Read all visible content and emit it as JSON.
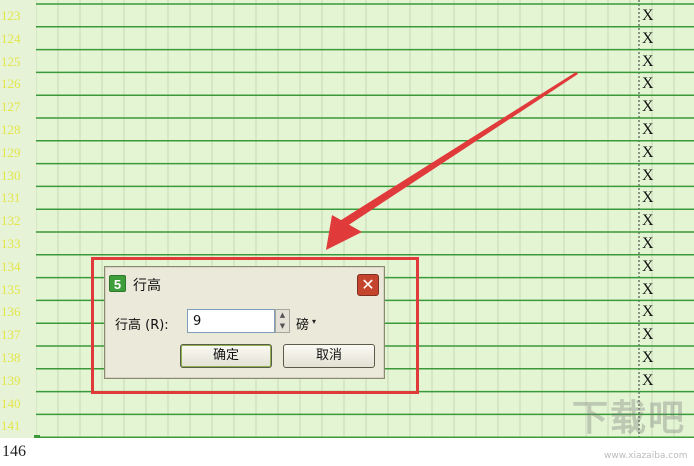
{
  "sheet": {
    "row_headers": [
      "123",
      "124",
      "125",
      "126",
      "127",
      "128",
      "129",
      "130",
      "131",
      "132",
      "133",
      "134",
      "135",
      "136",
      "137",
      "138",
      "139",
      "140",
      "141"
    ],
    "x_column_values": [
      "X",
      "X",
      "X",
      "X",
      "X",
      "X",
      "X",
      "X",
      "X",
      "X",
      "X",
      "X",
      "X",
      "X",
      "X",
      "X",
      "X"
    ],
    "bottom_row_label": "146",
    "colors": {
      "cell_bg": "#e4f5d4",
      "row_line": "#3a9a3a",
      "grid_line": "#c8d8b8",
      "header_text": "#e4e64a"
    }
  },
  "dialog": {
    "title": "行高",
    "app_icon_glyph": "5",
    "close_glyph": "✕",
    "field_label": "行高 (R):",
    "field_value": "9",
    "unit_label": "磅",
    "unit_arrow": "▾",
    "ok_label": "确定",
    "cancel_label": "取消"
  },
  "annotation": {
    "highlight_color": "#e03a3a",
    "arrow_color": "#e03a3a"
  },
  "watermark": {
    "text": "下载吧",
    "url": "www.xiazaiba.com"
  }
}
